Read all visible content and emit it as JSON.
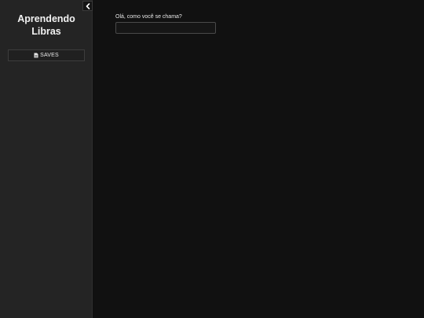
{
  "sidebar": {
    "title": "Aprendendo\nLibras",
    "collapse_icon": "chevron-left-icon",
    "saves_button": {
      "icon": "file-icon",
      "label": "SAVES"
    }
  },
  "main": {
    "name_prompt": "Olá, como você se chama?",
    "name_input_value": "",
    "name_input_placeholder": ""
  },
  "colors": {
    "sidebar_bg": "#242424",
    "main_bg": "#111111",
    "text": "#e6e6e6"
  }
}
